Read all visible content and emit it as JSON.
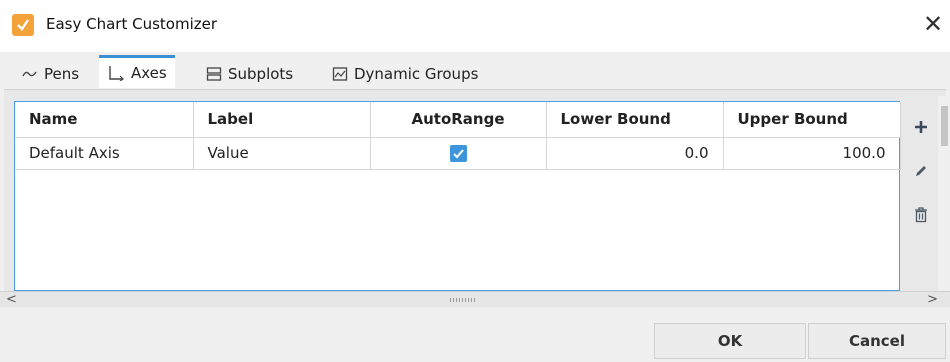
{
  "window": {
    "title": "Easy Chart Customizer",
    "close_glyph": "✕"
  },
  "tabs": [
    {
      "label": "Pens",
      "icon": "line-wave-icon",
      "active": false
    },
    {
      "label": "Axes",
      "icon": "axes-icon",
      "active": true
    },
    {
      "label": "Subplots",
      "icon": "subplots-icon",
      "active": false
    },
    {
      "label": "Dynamic Groups",
      "icon": "dynamic-groups-icon",
      "active": false
    }
  ],
  "table": {
    "columns": [
      "Name",
      "Label",
      "AutoRange",
      "Lower Bound",
      "Upper Bound"
    ],
    "rows": [
      {
        "name": "Default Axis",
        "label": "Value",
        "autorange": true,
        "lower": "0.0",
        "upper": "100.0"
      }
    ]
  },
  "side_buttons": [
    "add-icon",
    "edit-icon",
    "delete-icon"
  ],
  "footer": {
    "ok_label": "OK",
    "cancel_label": "Cancel"
  },
  "colors": {
    "accent": "#3e8fd2",
    "app_icon": "#f5a23a",
    "checkbox": "#3d96dc"
  }
}
